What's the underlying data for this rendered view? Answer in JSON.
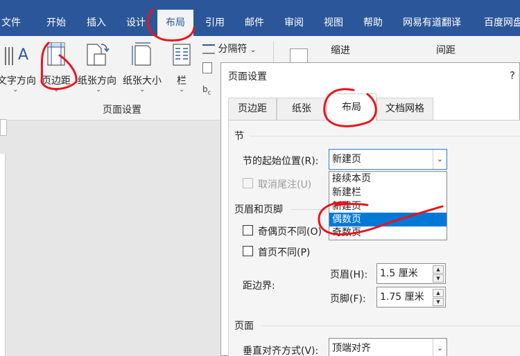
{
  "ribbon_tabs": [
    "文件",
    "开始",
    "插入",
    "设计",
    "布局",
    "引用",
    "邮件",
    "审阅",
    "视图",
    "帮助",
    "网易有道翻译",
    "百度网盘"
  ],
  "ribbon": {
    "text_direction": "文字方向",
    "margins": "页边距",
    "orientation": "纸张方向",
    "size": "纸张大小",
    "columns": "栏",
    "breaks": "分隔符",
    "indent": "缩进",
    "spacing": "间距",
    "group_label": "页面设置",
    "icon_letter": "A"
  },
  "dialog": {
    "title": "页面设置",
    "help": "?",
    "tabs": [
      "页边距",
      "纸张",
      "布局",
      "文档网格"
    ],
    "section_label": "节",
    "section_start_label": "节的起始位置(R):",
    "section_start_value": "新建页",
    "suppress_endnotes": "取消尾注(U)",
    "dropdown_options": [
      "接续本页",
      "新建栏",
      "新建页",
      "偶数页",
      "奇数页"
    ],
    "selected_option": "偶数页",
    "headers_footers_label": "页眉和页脚",
    "odd_even_label": "奇偶页不同(O)",
    "first_page_label": "首页不同(P)",
    "from_edge_label": "距边界:",
    "header_label": "页眉(H):",
    "header_value": "1.5 厘米",
    "footer_label": "页脚(F):",
    "footer_value": "1.75 厘米",
    "page_label": "页面",
    "vertical_align_label": "垂直对齐方式(V):",
    "vertical_align_value": "顶端对齐"
  },
  "colors": {
    "ribbon_blue": "#2b579a",
    "annotation_red": "#e8141c",
    "selection_blue": "#0078d7"
  },
  "icons": [
    "text-direction-icon",
    "margins-icon",
    "orientation-icon",
    "size-icon",
    "columns-icon",
    "breaks-icon",
    "line-numbers-icon",
    "hyphenation-icon",
    "dropdown-chevron-icon",
    "spin-up-icon",
    "spin-down-icon"
  ]
}
